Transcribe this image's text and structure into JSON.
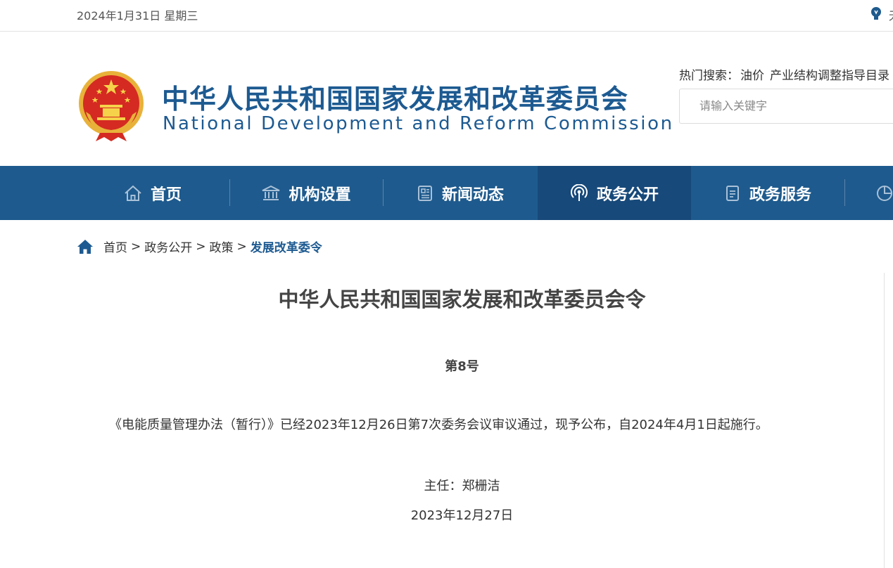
{
  "topbar": {
    "date": "2024年1月31日 星期三",
    "more": "无"
  },
  "header": {
    "title_cn": "中华人民共和国国家发展和改革委员会",
    "title_en": "National Development and Reform Commission",
    "hot_label": "热门搜索：",
    "hot_items": [
      "油价",
      "产业结构调整指导目录"
    ],
    "search_placeholder": "请输入关键字"
  },
  "nav": {
    "items": [
      {
        "label": "首页",
        "icon": "home-icon"
      },
      {
        "label": "机构设置",
        "icon": "institution-icon"
      },
      {
        "label": "新闻动态",
        "icon": "news-icon"
      },
      {
        "label": "政务公开",
        "icon": "broadcast-icon",
        "active": true
      },
      {
        "label": "政务服务",
        "icon": "document-icon"
      }
    ]
  },
  "breadcrumb": {
    "items": [
      "首页",
      "政务公开",
      "政策"
    ],
    "current": "发展改革委令",
    "separator": ">"
  },
  "article": {
    "title": "中华人民共和国国家发展和改革委员会令",
    "number": "第8号",
    "body": "《电能质量管理办法（暂行）》已经2023年12月26日第7次委务会议审议通过，现予公布，自2024年4月1日起施行。",
    "signature": "主任：郑栅洁",
    "date": "2023年12月27日"
  },
  "colors": {
    "brand": "#1e5a8d",
    "brand_active": "#17497a",
    "title_blue": "#1d5a91"
  }
}
